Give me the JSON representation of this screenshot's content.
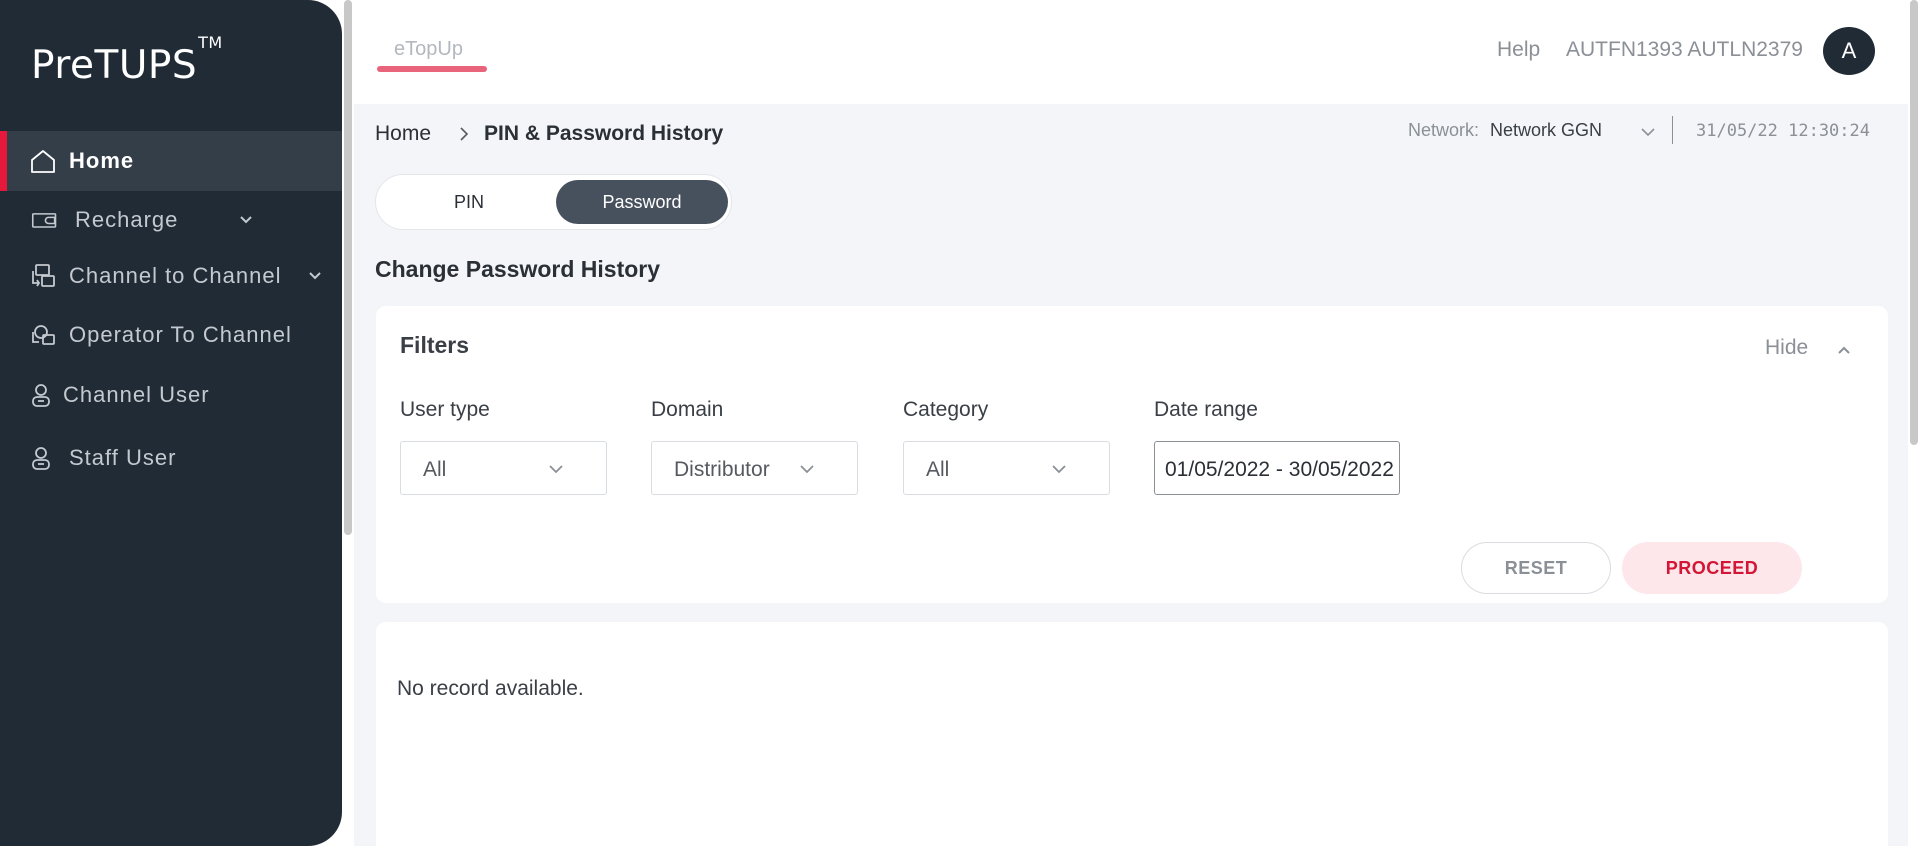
{
  "app": {
    "logo_text": "PreTUPS",
    "logo_mark": "TM"
  },
  "sidebar": {
    "items": [
      {
        "label": "Home",
        "icon": "home-icon",
        "active": true
      },
      {
        "label": "Recharge",
        "icon": "recharge-icon",
        "expandable": true
      },
      {
        "label": "Channel to Channel",
        "icon": "channel-transfer-icon",
        "expandable": true
      },
      {
        "label": "Operator To Channel",
        "icon": "operator-icon"
      },
      {
        "label": "Channel User",
        "icon": "user-icon"
      },
      {
        "label": "Staff User",
        "icon": "user-icon"
      }
    ]
  },
  "header": {
    "tab_label": "eTopUp",
    "help_label": "Help",
    "user_name": "AUTFN1393 AUTLN2379",
    "avatar_initial": "A"
  },
  "breadcrumb": {
    "home": "Home",
    "current": "PIN & Password History"
  },
  "network": {
    "label": "Network:",
    "value": "Network GGN",
    "datetime": "31/05/22 12:30:24"
  },
  "toggle": {
    "pin_label": "PIN",
    "password_label": "Password",
    "selected": "Password"
  },
  "section_title": "Change Password History",
  "filters": {
    "title": "Filters",
    "hide_label": "Hide",
    "user_type": {
      "label": "User type",
      "value": "All"
    },
    "domain": {
      "label": "Domain",
      "value": "Distributor"
    },
    "category": {
      "label": "Category",
      "value": "All"
    },
    "date_range": {
      "label": "Date range",
      "value": "01/05/2022 - 30/05/2022"
    },
    "reset_label": "RESET",
    "proceed_label": "PROCEED"
  },
  "results": {
    "empty_message": "No record available."
  },
  "colors": {
    "sidebar_bg": "#212b36",
    "accent": "#e5193b",
    "proceed_bg": "#fde7ea",
    "proceed_text": "#d41535",
    "toggle_active": "#47515d"
  }
}
